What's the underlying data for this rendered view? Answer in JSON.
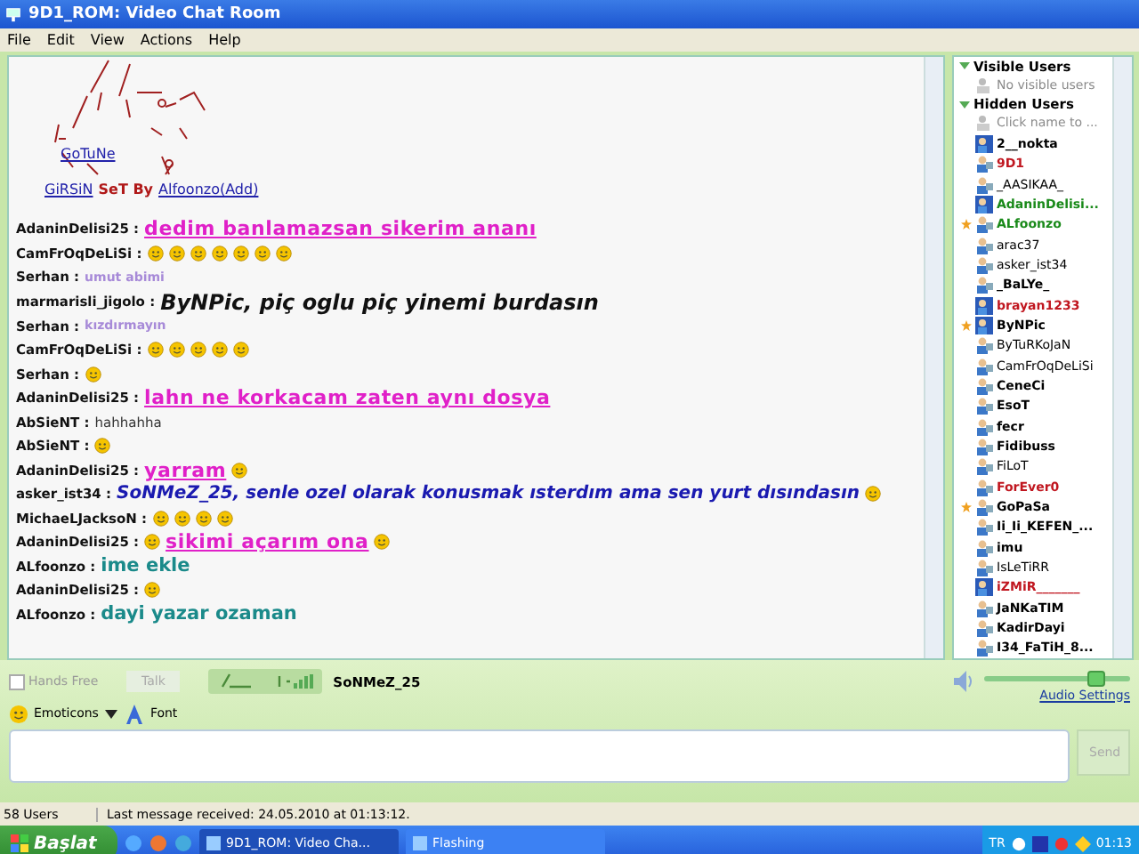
{
  "window": {
    "title": "9D1_ROM: Video Chat Room"
  },
  "menu": [
    "File",
    "Edit",
    "View",
    "Actions",
    "Help"
  ],
  "banner": {
    "link": "GoTuNe",
    "left": "GiRSiN",
    "set_by": "SeT By",
    "author": "Alfoonzo(Add)"
  },
  "messages": [
    {
      "user": "AdaninDelisi25 :",
      "parts": [
        {
          "kind": "magenta",
          "text": "dedim banlamazsan sikerim ananı"
        }
      ]
    },
    {
      "user": "CamFrOqDeLiSi :",
      "parts": [
        {
          "kind": "smiley"
        },
        {
          "kind": "smiley"
        },
        {
          "kind": "smiley"
        },
        {
          "kind": "smiley"
        },
        {
          "kind": "smiley"
        },
        {
          "kind": "smiley"
        },
        {
          "kind": "smiley"
        }
      ]
    },
    {
      "user": "Serhan :",
      "parts": [
        {
          "kind": "lilac",
          "text": "umut abimi"
        }
      ]
    },
    {
      "user": "marmarisli_jigolo :",
      "parts": [
        {
          "kind": "bolditalic",
          "text": "ByNPic, piç  oglu piç  yinemi burdasın"
        }
      ]
    },
    {
      "user": "Serhan :",
      "parts": [
        {
          "kind": "lilac",
          "text": "kızdırmayın"
        }
      ]
    },
    {
      "user": "CamFrOqDeLiSi :",
      "parts": [
        {
          "kind": "smiley"
        },
        {
          "kind": "smiley"
        },
        {
          "kind": "smiley"
        },
        {
          "kind": "smiley"
        },
        {
          "kind": "smiley"
        }
      ]
    },
    {
      "user": "Serhan :",
      "parts": [
        {
          "kind": "smiley"
        }
      ]
    },
    {
      "user": "AdaninDelisi25 :",
      "parts": [
        {
          "kind": "magenta",
          "text": "lahn ne korkacam zaten aynı dosya"
        }
      ]
    },
    {
      "user": "AbSieNT :",
      "parts": [
        {
          "kind": "plain",
          "text": "hahhahha"
        }
      ]
    },
    {
      "user": "AbSieNT :",
      "parts": [
        {
          "kind": "smiley"
        }
      ]
    },
    {
      "user": "AdaninDelisi25 :",
      "parts": [
        {
          "kind": "magenta",
          "text": "yarram"
        },
        {
          "kind": "smiley"
        }
      ]
    },
    {
      "user": "asker_ist34 :",
      "parts": [
        {
          "kind": "blueitalic",
          "text": "SoNMeZ_25, senle ozel olarak konusmak ısterdım ama sen yurt dısındasın"
        },
        {
          "kind": "smiley"
        }
      ]
    },
    {
      "user": "MichaeLJacksoN :",
      "parts": [
        {
          "kind": "smiley"
        },
        {
          "kind": "smiley"
        },
        {
          "kind": "smiley"
        },
        {
          "kind": "smiley"
        }
      ]
    },
    {
      "user": "AdaninDelisi25 :",
      "parts": [
        {
          "kind": "smiley"
        },
        {
          "kind": "magenta",
          "text": "sikimi açarım ona"
        },
        {
          "kind": "smiley"
        }
      ]
    },
    {
      "user": "ALfoonzo :",
      "parts": [
        {
          "kind": "teal",
          "text": "ime ekle"
        }
      ]
    },
    {
      "user": "AdaninDelisi25 :",
      "parts": [
        {
          "kind": "smiley"
        }
      ]
    },
    {
      "user": "ALfoonzo :",
      "parts": [
        {
          "kind": "teal",
          "text": "dayi yazar ozaman"
        }
      ]
    }
  ],
  "user_groups": [
    {
      "title": "Visible Users",
      "expanded": true,
      "users": [
        {
          "name": "No visible users",
          "kind": "hint",
          "color": "#8a8a8a",
          "bold": false,
          "starred": false
        }
      ]
    },
    {
      "title": "Hidden Users",
      "expanded": true,
      "users": [
        {
          "name": "Click name to ...",
          "kind": "hint",
          "color": "#8a8a8a",
          "bold": false,
          "starred": false
        },
        {
          "name": "2__nokta",
          "kind": "cam",
          "color": "#000000",
          "bold": true,
          "starred": false
        },
        {
          "name": "9D1",
          "kind": "user",
          "color": "#c0161f",
          "bold": true,
          "starred": false
        },
        {
          "name": "_AASIKAA_",
          "kind": "user",
          "color": "#000000",
          "bold": false,
          "starred": false
        },
        {
          "name": "AdaninDelisi...",
          "kind": "cam",
          "color": "#1a8a1a",
          "bold": true,
          "starred": false
        },
        {
          "name": "ALfoonzo",
          "kind": "user",
          "color": "#1a8a1a",
          "bold": true,
          "starred": true
        },
        {
          "name": "arac37",
          "kind": "user",
          "color": "#000000",
          "bold": false,
          "starred": false
        },
        {
          "name": "asker_ist34",
          "kind": "user",
          "color": "#000000",
          "bold": false,
          "starred": false
        },
        {
          "name": "_BaLYe_",
          "kind": "user",
          "color": "#000000",
          "bold": true,
          "starred": false
        },
        {
          "name": "brayan1233",
          "kind": "cam",
          "color": "#c0161f",
          "bold": true,
          "starred": false
        },
        {
          "name": "ByNPic",
          "kind": "cam",
          "color": "#000000",
          "bold": true,
          "starred": true
        },
        {
          "name": "ByTuRKoJaN",
          "kind": "user",
          "color": "#000000",
          "bold": false,
          "starred": false
        },
        {
          "name": "CamFrOqDeLiSi",
          "kind": "user",
          "color": "#000000",
          "bold": false,
          "starred": false
        },
        {
          "name": "CeneCi",
          "kind": "user",
          "color": "#000000",
          "bold": true,
          "starred": false
        },
        {
          "name": "EsoT",
          "kind": "user",
          "color": "#000000",
          "bold": true,
          "starred": false
        },
        {
          "name": "fecr",
          "kind": "user",
          "color": "#000000",
          "bold": true,
          "starred": false
        },
        {
          "name": "Fidibuss",
          "kind": "user",
          "color": "#000000",
          "bold": true,
          "starred": false
        },
        {
          "name": "FiLoT",
          "kind": "user",
          "color": "#000000",
          "bold": false,
          "starred": false
        },
        {
          "name": "ForEver0",
          "kind": "user",
          "color": "#c0161f",
          "bold": true,
          "starred": false
        },
        {
          "name": "GoPaSa",
          "kind": "user",
          "color": "#000000",
          "bold": true,
          "starred": true
        },
        {
          "name": "Ii_Ii_KEFEN_...",
          "kind": "user",
          "color": "#000000",
          "bold": true,
          "starred": false
        },
        {
          "name": "imu",
          "kind": "user",
          "color": "#000000",
          "bold": true,
          "starred": false
        },
        {
          "name": "IsLeTiRR",
          "kind": "user",
          "color": "#000000",
          "bold": false,
          "starred": false
        },
        {
          "name": "iZMiR_______",
          "kind": "cam",
          "color": "#c0161f",
          "bold": true,
          "starred": false
        },
        {
          "name": "JaNKaTIM",
          "kind": "user",
          "color": "#000000",
          "bold": true,
          "starred": false
        },
        {
          "name": "KadirDayi",
          "kind": "user",
          "color": "#000000",
          "bold": true,
          "starred": false
        },
        {
          "name": "I34_FaTiH_8...",
          "kind": "user",
          "color": "#000000",
          "bold": true,
          "starred": false
        }
      ]
    }
  ],
  "controls": {
    "hands_free": {
      "label": "Hands Free",
      "checked": false
    },
    "talk": "Talk",
    "speaker": "SoNMeZ_25",
    "volume": {
      "level": 0.75
    },
    "audio_settings": "Audio Settings",
    "emoticons": "Emoticons",
    "font": "Font",
    "send": "Send"
  },
  "status_bar": {
    "users": "58 Users",
    "last_message": "Last message received: 24.05.2010 at 01:13:12."
  },
  "taskbar": {
    "start": "Başlat",
    "tasks": [
      {
        "label": "9D1_ROM: Video Cha...",
        "selected": true
      },
      {
        "label": "Flashing",
        "selected": false
      }
    ],
    "language": "TR",
    "clock": "01:13"
  }
}
